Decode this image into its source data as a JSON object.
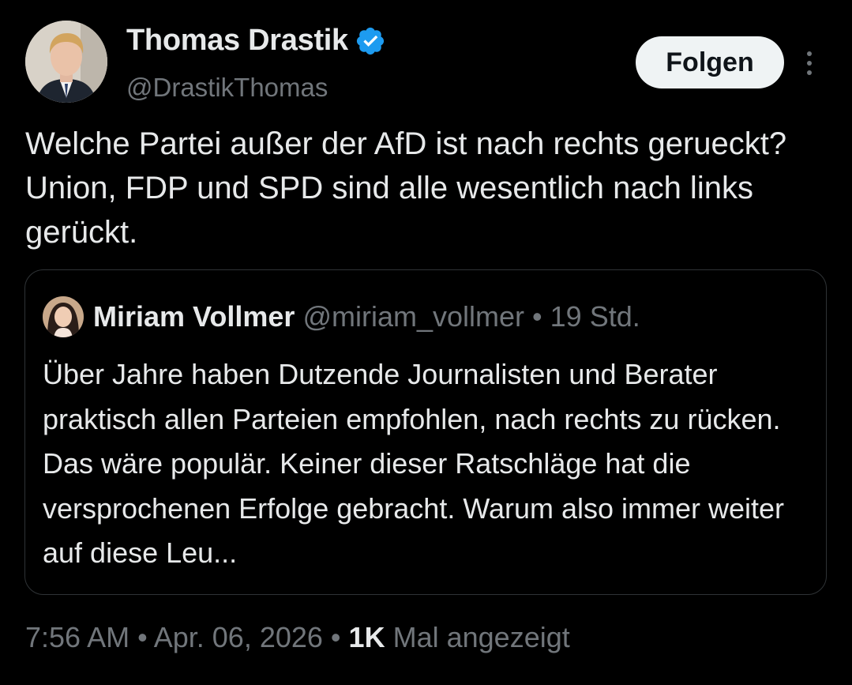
{
  "author": {
    "name": "Thomas Drastik",
    "handle": "@DrastikThomas",
    "verified_color": "#1d9bf0"
  },
  "follow_label": "Folgen",
  "tweet_text": "Welche Partei außer der AfD ist nach rechts gerueckt? Union, FDP und SPD sind alle wesentlich nach links gerückt.",
  "quote": {
    "name": "Miriam Vollmer",
    "handle": "@miriam_vollmer",
    "separator": "•",
    "time": "19 Std.",
    "text": "Über Jahre haben Dutzende Journalisten und Berater praktisch allen Parteien empfohlen, nach rechts zu rücken. Das wäre populär. Keiner dieser Ratschläge hat die versprochenen Erfolge gebracht. Warum also immer weiter auf diese Leu..."
  },
  "footer": {
    "time": "7:56 AM",
    "sep1": "•",
    "date": "Apr. 06, 2026",
    "sep2": "•",
    "views_count": "1K",
    "views_label": "Mal angezeigt"
  }
}
